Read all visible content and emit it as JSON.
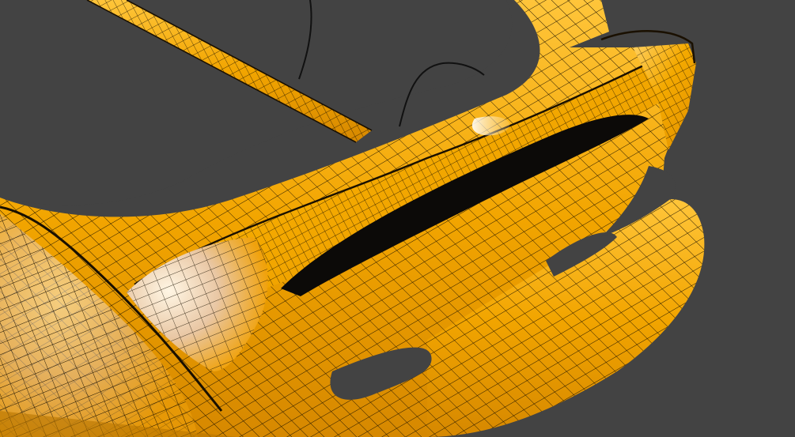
{
  "viewport": {
    "subject": "car-rear-spoiler-wireframe",
    "colors": {
      "background": "#434343",
      "surface": "#f2a500",
      "surface_dark": "#d98a00",
      "surface_light": "#ffc83a",
      "highlight": "#fff1d8",
      "wire": "#1a1000",
      "opening": "#0c0a08"
    }
  }
}
